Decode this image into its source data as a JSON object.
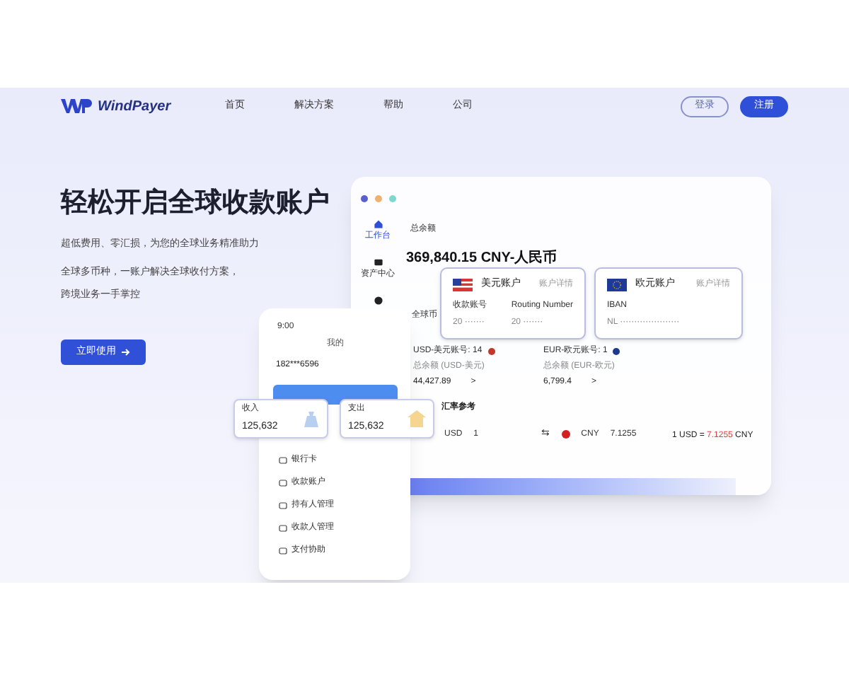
{
  "nav": {
    "logo": "WindPayer",
    "links": [
      "首页",
      "解决方案",
      "帮助",
      "公司"
    ],
    "login": "登录",
    "signup": "注册"
  },
  "hero": {
    "title": "轻松开启全球收款账户",
    "subtitle": "超低费用、零汇损，为您的全球业务精准助力",
    "lines": [
      "全球多币种，一账户解决全球收付方案，",
      "跨境业务一手掌控"
    ],
    "cta": "立即使用"
  },
  "dashboard": {
    "sidebar": [
      {
        "label": "工作台",
        "selected": true
      },
      {
        "label": "资产中心",
        "selected": false
      },
      {
        "selected": false
      }
    ],
    "balance_label": "总余额",
    "balance": "369,840.15 CNY-人民币",
    "currencies_label": "全球币",
    "swap": "⇆",
    "accounts": [
      {
        "label": "USD-美元账号: 14",
        "sub": "总余额 (USD-美元)",
        "value": "44,427.89",
        "arrow": ">",
        "color": "#c0392b"
      },
      {
        "label": "EUR-欧元账号: 1",
        "sub": "总余额 (EUR-欧元)",
        "value": "6,799.4",
        "arrow": ">",
        "color": "#1e3a8a"
      }
    ],
    "rate_label": "汇率参考",
    "from": "USD",
    "amount": "1",
    "to": "CNY",
    "converted": "7.1255",
    "rate_prefix": "1 USD = ",
    "rate_value": "7.1255",
    "rate_suffix": " CNY"
  },
  "account_cards": [
    {
      "kind": "usd",
      "title": "美元账户",
      "link": "账户详情",
      "fields": [
        {
          "label": "收款账号",
          "value": "20 ·······"
        },
        {
          "label": "Routing Number",
          "value": "20 ·······"
        }
      ]
    },
    {
      "kind": "eur",
      "title": "欧元账户",
      "link": "账户详情",
      "fields": [
        {
          "label": "IBAN",
          "value": "NL ·····················"
        }
      ]
    }
  ],
  "phone": {
    "time": "9:00",
    "title": "我的",
    "account": "182***6596",
    "menu": [
      "银行卡",
      "收款账户",
      "持有人管理",
      "收款人管理",
      "支付协助"
    ]
  },
  "stats": [
    {
      "kind": "income",
      "label": "收入",
      "value": "125,632"
    },
    {
      "kind": "expense",
      "label": "支出",
      "value": "125,632"
    }
  ]
}
